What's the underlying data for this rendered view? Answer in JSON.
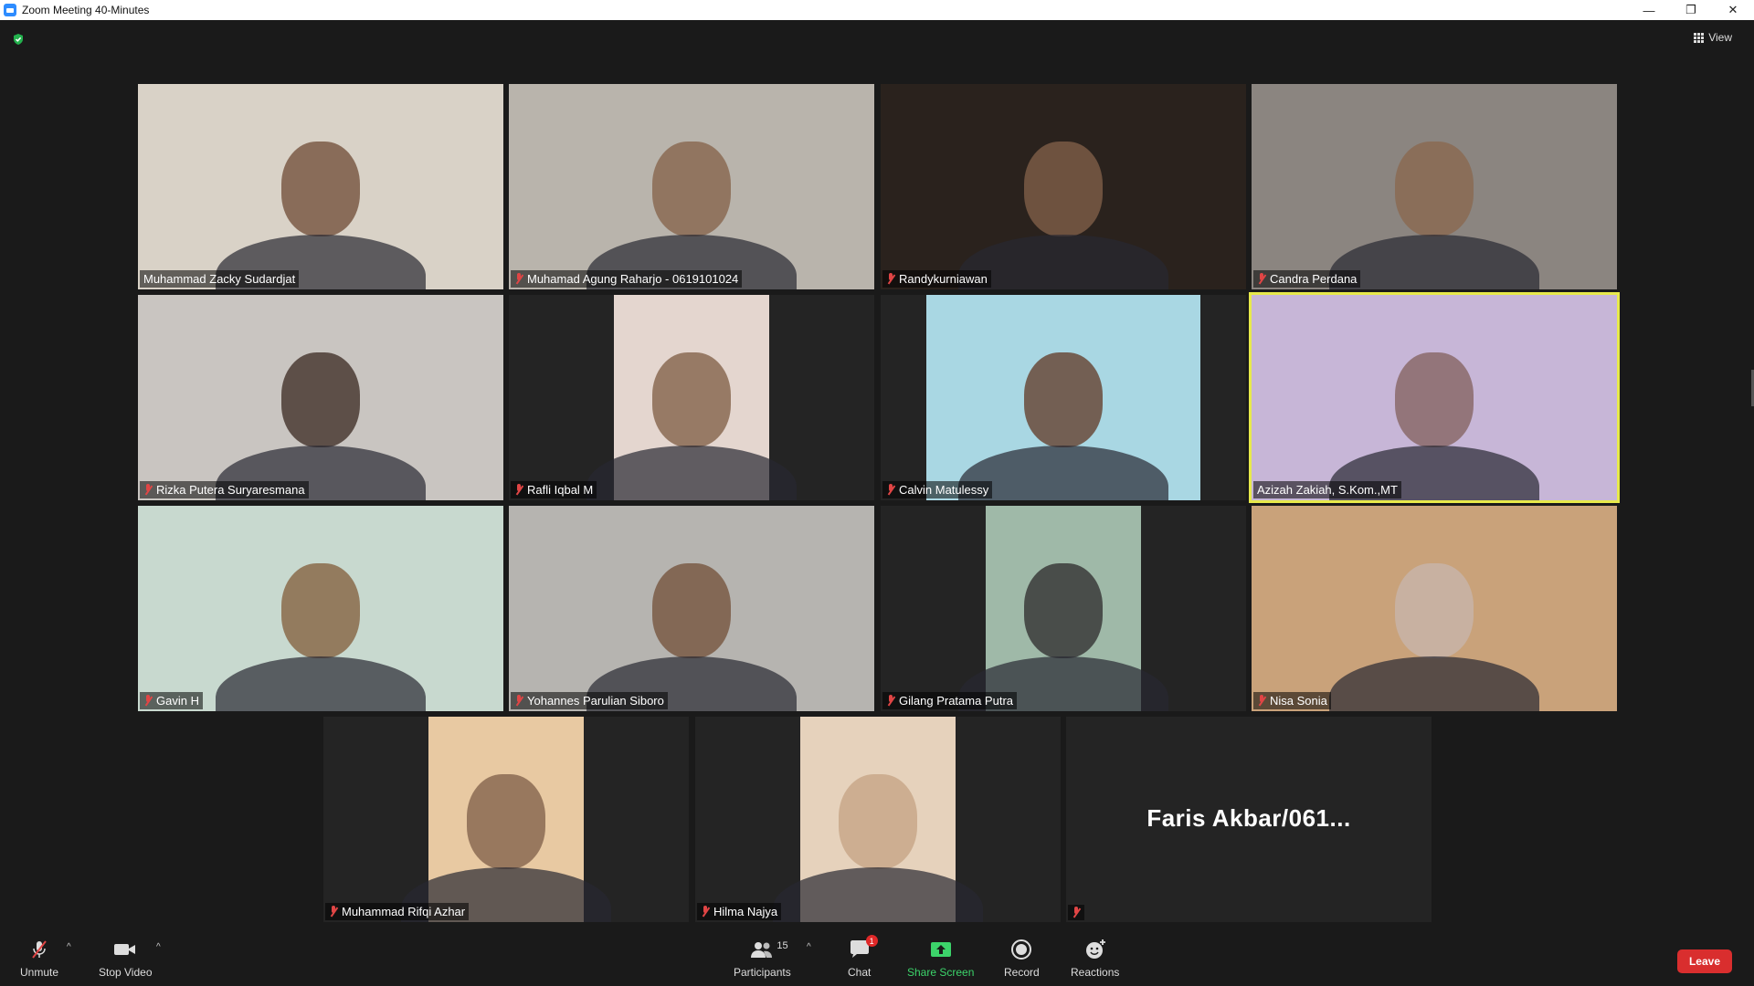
{
  "window": {
    "title": "Zoom Meeting 40-Minutes"
  },
  "top": {
    "view_label": "View"
  },
  "participants": [
    {
      "name": "Muhammad Zacky Sudardjat",
      "muted": false,
      "bg": "#d9d2c7",
      "face": "#7a5a45"
    },
    {
      "name": "Muhamad Agung Raharjo - 0619101024",
      "muted": true,
      "bg": "#b9b4ac",
      "face": "#8a6a52"
    },
    {
      "name": "Randykurniawan",
      "muted": true,
      "bg": "#2a221d",
      "face": "#7a5a45"
    },
    {
      "name": "Candra Perdana",
      "muted": true,
      "bg": "#8b8580",
      "face": "#8a6a52"
    },
    {
      "name": "Rizka Putera Suryaresmana",
      "muted": true,
      "bg": "#c9c5c1",
      "face": "#4a3a32"
    },
    {
      "name": "Rafli Iqbal M",
      "muted": true,
      "bg": "#e4d6cf",
      "face": "#8a6a52"
    },
    {
      "name": "Calvin Matulessy",
      "muted": true,
      "bg": "#a9d7e3",
      "face": "#6a4a3a"
    },
    {
      "name": "Azizah Zakiah, S.Kom.,MT",
      "muted": false,
      "bg": "#c7b6d7",
      "face": "#8a6a6a"
    },
    {
      "name": "Gavin H",
      "muted": true,
      "bg": "#c8d9cf",
      "face": "#8a6a4a"
    },
    {
      "name": "Yohannes Parulian Siboro",
      "muted": true,
      "bg": "#b6b4b0",
      "face": "#7a5a45"
    },
    {
      "name": "Gilang Pratama Putra",
      "muted": true,
      "bg": "#9fb9a8",
      "face": "#3a3a3a"
    },
    {
      "name": "Nisa Sonia",
      "muted": true,
      "bg": "#c9a27a",
      "face": "#c8b4a8"
    },
    {
      "name": "Muhammad Rifqi Azhar",
      "muted": true,
      "bg": "#e8c9a2",
      "face": "#8a6a52"
    },
    {
      "name": "Hilma Najya",
      "muted": true,
      "bg": "#e6d2bc",
      "face": "#c8a88a"
    },
    {
      "name": "",
      "muted": true,
      "bg": "#242424",
      "face": "",
      "display_name": "Faris  Akbar/061..."
    }
  ],
  "toolbar": {
    "unmute": "Unmute",
    "stop_video": "Stop Video",
    "participants": "Participants",
    "participants_count": "15",
    "chat": "Chat",
    "chat_badge": "1",
    "share_screen": "Share Screen",
    "record": "Record",
    "reactions": "Reactions",
    "leave": "Leave"
  }
}
